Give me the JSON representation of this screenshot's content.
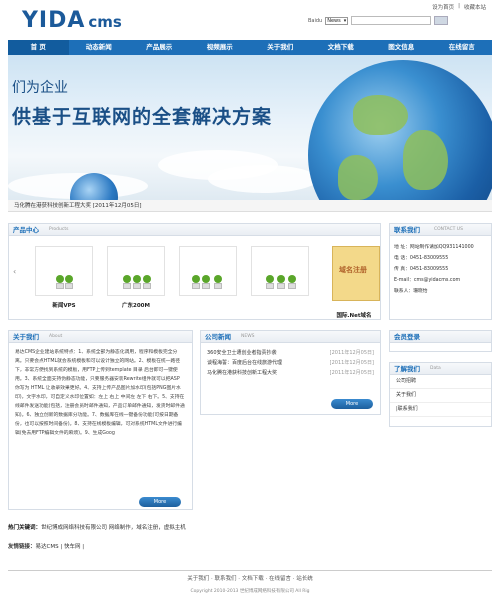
{
  "header": {
    "logo_main": "YIDA",
    "logo_cms": "cms",
    "top_links": [
      "设为首页",
      "|",
      "收藏本站"
    ],
    "search_label": "Baidu",
    "search_option": "News",
    "search_placeholder": ""
  },
  "nav": {
    "items": [
      "首 页",
      "动态新闻",
      "产品展示",
      "视频展示",
      "关于我们",
      "文档下载",
      "图文信息",
      "在线留言"
    ]
  },
  "banner": {
    "line1": "们为企业",
    "line2": "供基于互联网的全套解决方案",
    "news": "马化腾在港获科技创新工程大奖 [2011年12月05日]"
  },
  "products": {
    "title": "产品中心",
    "subtitle": "Products",
    "items": [
      "新闻VPS",
      "广东200M",
      "",
      "",
      "国际.Net域名"
    ],
    "special_label": "域名注册",
    "prev": "‹",
    "next": "›"
  },
  "contact": {
    "title": "联系我们",
    "subtitle": "CONTACT US",
    "lines": [
      "地 址：网站制作请加QQ931141000",
      "电 话：0451-83009555",
      "传 真：0451-83009555",
      "E-mail：cms@yidacms.com",
      "联系人：珊晓怡"
    ]
  },
  "about": {
    "title": "关于我们",
    "subtitle": "About",
    "text": "易达CMS企业建站系统特点：1、系统全部为静态化调用，程序和模板完全分离。只要会点HTML就会系统模板和可以设计独立的网站。2、模板在统一路径下，非常方便找到系统的模板，用FTP上传到template 目录 后台即可一键使用。3、系统全面支持伪静态功能，只要服务器安装Rewrite组件就可以把ASP 你写为 HTML 让收录效果更好。4、支持上传产品图片加水印(包括PNG图片水印)，文字水印，可自定义水印位置如：左上 右上 中间左 左下 右下。5、支持在线邮件发送功能(包括，注册会员时邮件通知，产品订单邮件通知，发货时邮件通知)。6、独立创新的数据库分功能。7、数据库在线一键备份功能(可按日期备份，也可以按照时间备份)。8、支持在线模板编辑，可对系统HTML文件进行编辑(免去用FTP编辑文件的麻烦)。9、生成Goog",
    "more": "More"
  },
  "news": {
    "title": "公司新闻",
    "subtitle": "NEWS",
    "items": [
      {
        "title": "360安全卫士遭创业者指责抄袭",
        "date": "[2011年12月05日]"
      },
      {
        "title": "谈程海誓：百度后台在线旅游代理",
        "date": "[2011年12月05日]"
      },
      {
        "title": "马化腾在港获科技创新工程大奖",
        "date": "[2011年12月05日]"
      }
    ],
    "more": "More"
  },
  "member": {
    "title": "会员登录"
  },
  "learn": {
    "title": "了解我们",
    "subtitle": "Data",
    "items": [
      "公司招聘",
      "关于我们",
      "|联系我们"
    ]
  },
  "footer": {
    "keywords_label": "热门关键词：",
    "keywords": "世纪博成网络科技有限公司 网络制作，域名注册，虚拟主机",
    "links_label": "友情链接：",
    "links": "易达CMS | 快车网 |",
    "bar": "关于我们 · 联系我们 · 文档下载 · 在线留言 · 站长统",
    "copyright": "Copyright 2010-2013 世纪博成网络科技有限公司 All Rig"
  }
}
